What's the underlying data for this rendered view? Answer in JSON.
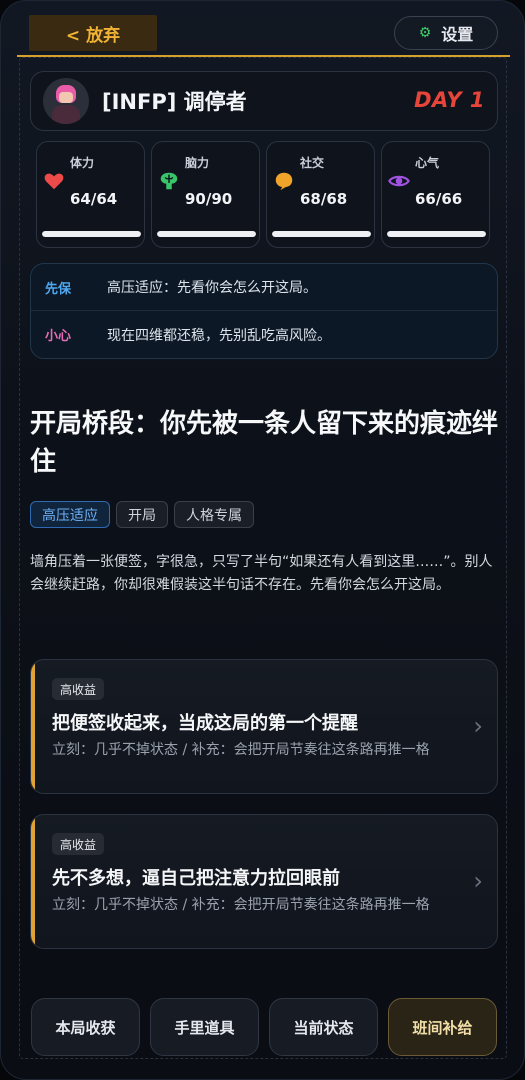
{
  "topbar": {
    "back_label": "< 放弃",
    "settings_label": "设置"
  },
  "profile": {
    "title": "[INFP] 调停者",
    "day": "DAY 1"
  },
  "stats": [
    {
      "label": "体力",
      "value": "64/64",
      "fraction": 1.0,
      "icon": "heart-icon",
      "color": "#ef4a4a"
    },
    {
      "label": "脑力",
      "value": "90/90",
      "fraction": 1.0,
      "icon": "brain-icon",
      "color": "#39c46a"
    },
    {
      "label": "社交",
      "value": "68/68",
      "fraction": 1.0,
      "icon": "chat-bubble-icon",
      "color": "#f0a52a"
    },
    {
      "label": "心气",
      "value": "66/66",
      "fraction": 1.0,
      "icon": "eye-icon",
      "color": "#a052e0"
    }
  ],
  "hints": [
    {
      "tag": "先保",
      "text": "高压适应：先看你会怎么开这局。",
      "color": "#4fa8f0"
    },
    {
      "tag": "小心",
      "text": "现在四维都还稳，先别乱吃高风险。",
      "color": "#e56db5"
    }
  ],
  "scene": {
    "title": "开局桥段：你先被一条人留下来的痕迹绊住",
    "tags": [
      "高压适应",
      "开局",
      "人格专属"
    ],
    "description": "墙角压着一张便签，字很急，只写了半句“如果还有人看到这里……”。别人会继续赶路，你却很难假装这半句话不存在。先看你会怎么开这局。"
  },
  "choices": [
    {
      "badge": "高收益",
      "title": "把便签收起来，当成这局的第一个提醒",
      "sub": "立刻：几乎不掉状态 / 补充：会把开局节奏往这条路再推一格"
    },
    {
      "badge": "高收益",
      "title": "先不多想，逼自己把注意力拉回眼前",
      "sub": "立刻：几乎不掉状态 / 补充：会把开局节奏往这条路再推一格"
    }
  ],
  "nav": [
    "本局收获",
    "手里道具",
    "当前状态",
    "班间补给"
  ]
}
